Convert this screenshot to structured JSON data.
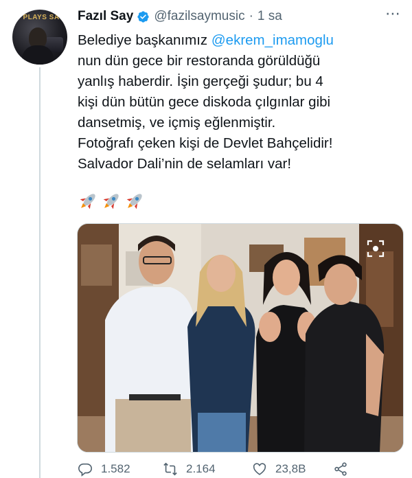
{
  "author": {
    "name": "Fazıl Say",
    "handle": "@fazilsaymusic",
    "separator": "·",
    "time": "1 sa",
    "avatar_text": "Y PLAYS SAY"
  },
  "tweet": {
    "line1_pre": "Belediye başkanımız ",
    "mention": "@ekrem_imamoglu",
    "line2": "nun dün gece bir restoranda görüldüğü",
    "line3": "yanlış haberdir. İşin gerçeği şudur; bu 4",
    "line4": "kişi dün bütün gece diskoda çılgınlar gibi",
    "line5": "dansetmiş, ve içmiş eğlenmiştir.",
    "line6": "Fotoğrafı çeken kişi de Devlet Bahçelidir!",
    "line7": "Salvador Dali’nin de selamları var!",
    "emoji_count": 3,
    "emoji_name": "rocket-emoji"
  },
  "more_label": "⋯",
  "actions": {
    "replies": "1.582",
    "retweets": "2.164",
    "likes": "23,8B"
  },
  "colors": {
    "link": "#1d9bf0",
    "secondary_text": "#536471",
    "verified": "#1d9bf0",
    "border": "#cfd9de"
  },
  "icons": [
    "more-icon",
    "verified-badge-icon",
    "reply-icon",
    "retweet-icon",
    "like-icon",
    "share-icon",
    "zoom-icon"
  ]
}
